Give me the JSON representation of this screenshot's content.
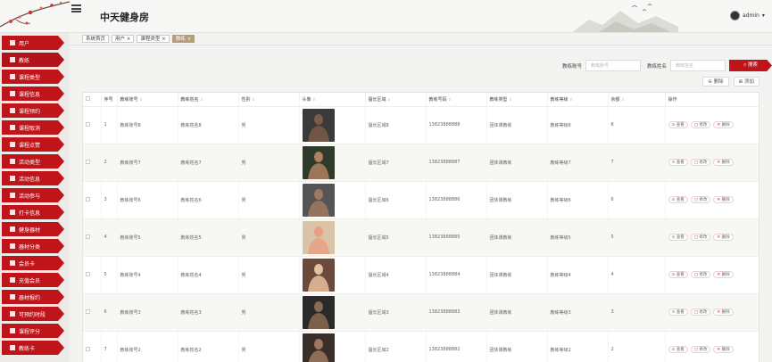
{
  "app": {
    "title": "中天健身房",
    "user": "admin"
  },
  "sidebar": {
    "items": [
      {
        "label": "用户"
      },
      {
        "label": "教练"
      },
      {
        "label": "课程类型"
      },
      {
        "label": "课程信息"
      },
      {
        "label": "课程预约"
      },
      {
        "label": "课程取消"
      },
      {
        "label": "课程点赞"
      },
      {
        "label": "活动类型"
      },
      {
        "label": "活动信息"
      },
      {
        "label": "活动参与"
      },
      {
        "label": "打卡信息"
      },
      {
        "label": "健身器材"
      },
      {
        "label": "器材分类"
      },
      {
        "label": "会员卡"
      },
      {
        "label": "充值会员"
      },
      {
        "label": "器材报约"
      },
      {
        "label": "可预约时段"
      },
      {
        "label": "课程评分"
      },
      {
        "label": "教练卡"
      }
    ]
  },
  "tabs": [
    {
      "label": "系统首页"
    },
    {
      "label": "用户"
    },
    {
      "label": "课程类型"
    },
    {
      "label": "教练"
    }
  ],
  "search": {
    "account_label": "教练账号",
    "account_placeholder": "教练账号",
    "name_label": "教练姓名",
    "name_placeholder": "教练姓名",
    "button": "搜索"
  },
  "tools": {
    "delete": "删除",
    "add": "添加"
  },
  "table": {
    "headers": [
      "序号",
      "教练账号",
      "教练姓名",
      "性别",
      "头像",
      "擅长区域",
      "教练号码",
      "教练类型",
      "教练等级",
      "余额",
      "操作"
    ],
    "rows": [
      {
        "no": "1",
        "account": "教练账号8",
        "name": "教练姓名8",
        "gender": "男",
        "area": "擅长区域8",
        "phone": "13823888888",
        "type": "团体课教练",
        "level": "教练等级8",
        "balance": "8"
      },
      {
        "no": "2",
        "account": "教练账号7",
        "name": "教练姓名7",
        "gender": "男",
        "area": "擅长区域7",
        "phone": "13823888887",
        "type": "团体课教练",
        "level": "教练等级7",
        "balance": "7"
      },
      {
        "no": "3",
        "account": "教练账号6",
        "name": "教练姓名6",
        "gender": "男",
        "area": "擅长区域6",
        "phone": "13823888886",
        "type": "团体课教练",
        "level": "教练等级6",
        "balance": "6"
      },
      {
        "no": "4",
        "account": "教练账号5",
        "name": "教练姓名5",
        "gender": "男",
        "area": "擅长区域5",
        "phone": "13823888885",
        "type": "团体课教练",
        "level": "教练等级5",
        "balance": "5"
      },
      {
        "no": "5",
        "account": "教练账号4",
        "name": "教练姓名4",
        "gender": "男",
        "area": "擅长区域4",
        "phone": "13823888884",
        "type": "团体课教练",
        "level": "教练等级4",
        "balance": "4"
      },
      {
        "no": "6",
        "account": "教练账号3",
        "name": "教练姓名3",
        "gender": "男",
        "area": "擅长区域3",
        "phone": "13823888883",
        "type": "团体课教练",
        "level": "教练等级3",
        "balance": "3"
      },
      {
        "no": "7",
        "account": "教练账号2",
        "name": "教练姓名2",
        "gender": "男",
        "area": "擅长区域2",
        "phone": "13823888882",
        "type": "团体课教练",
        "level": "教练等级2",
        "balance": "2"
      }
    ],
    "actions": {
      "view": "查看",
      "edit": "修改",
      "delete": "删除"
    }
  },
  "colors": {
    "accent": "#c0141b",
    "tab_active": "#b89c78"
  }
}
